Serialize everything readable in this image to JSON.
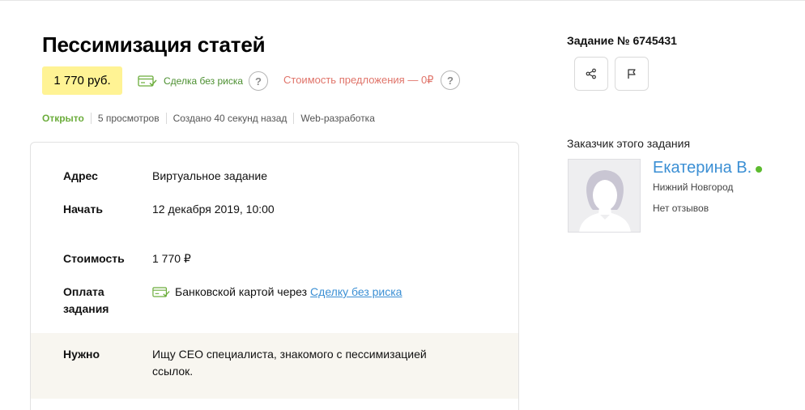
{
  "task": {
    "title": "Пессимизация статей",
    "price_badge": "1 770 руб.",
    "safe_deal_label": "Сделка без риска",
    "offer_cost": "Стоимость предложения — 0₽",
    "help_symbol": "?",
    "number": "Задание № 6745431"
  },
  "meta": {
    "status": "Открыто",
    "views": "5 просмотров",
    "created": "Создано 40 секунд назад",
    "category": "Web-разработка"
  },
  "details": {
    "address_label": "Адрес",
    "address_value": "Виртуальное задание",
    "start_label": "Начать",
    "start_value": "12 декабря 2019, 10:00",
    "cost_label": "Стоимость",
    "cost_value": "1 770 ₽",
    "payment_label": "Оплата задания",
    "payment_text": "Банковской картой через",
    "payment_link": "Сделку без риска",
    "need_label": "Нужно",
    "need_value": "Ищу СЕО специалиста, знакомого с пессимизацией ссылок."
  },
  "customer": {
    "heading": "Заказчик этого задания",
    "name": "Екатерина В.",
    "city": "Нижний Новгород",
    "reviews": "Нет отзывов",
    "online": true
  },
  "icons": {
    "share": "share-icon",
    "flag": "flag-icon",
    "card": "credit-card-check-icon",
    "avatar": "user-silhouette-icon"
  },
  "colors": {
    "price_badge_bg": "#fff394",
    "status_green": "#6cad3c",
    "safe_deal_green": "#4b8f2f",
    "offer_red": "#e0746a",
    "link_blue": "#3b8fd4",
    "online_green": "#5dbb2f",
    "need_band_bg": "#f8f6f0"
  }
}
